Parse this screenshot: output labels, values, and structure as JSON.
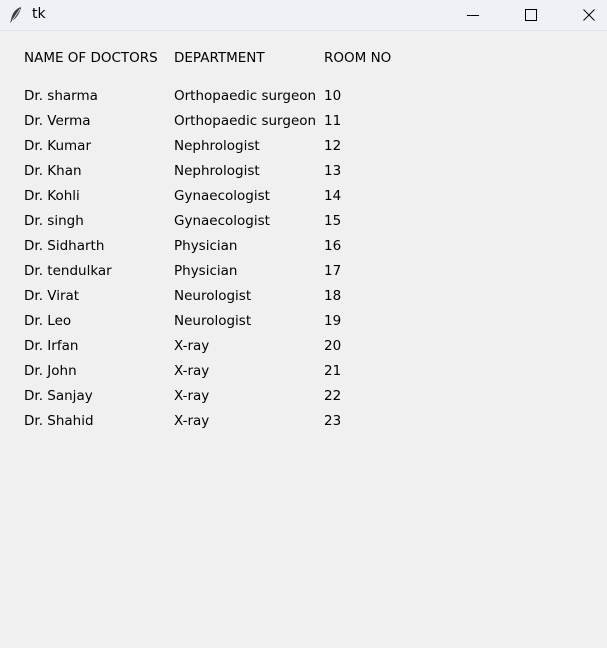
{
  "window": {
    "title": "tk"
  },
  "table": {
    "headers": [
      "NAME OF DOCTORS",
      "DEPARTMENT",
      "ROOM NO"
    ],
    "rows": [
      [
        "Dr. sharma",
        "Orthopaedic surgeon",
        "10"
      ],
      [
        "Dr. Verma",
        "Orthopaedic surgeon",
        "11"
      ],
      [
        "Dr. Kumar",
        "Nephrologist",
        "12"
      ],
      [
        "Dr. Khan",
        "Nephrologist",
        "13"
      ],
      [
        "Dr. Kohli",
        "Gynaecologist",
        "14"
      ],
      [
        "Dr. singh",
        "Gynaecologist",
        "15"
      ],
      [
        "Dr. Sidharth",
        "Physician",
        "16"
      ],
      [
        "Dr. tendulkar",
        "Physician",
        "17"
      ],
      [
        "Dr. Virat",
        "Neurologist",
        "18"
      ],
      [
        "Dr. Leo",
        "Neurologist",
        "19"
      ],
      [
        "Dr. Irfan",
        "X-ray",
        "20"
      ],
      [
        "Dr. John",
        "X-ray",
        "21"
      ],
      [
        "Dr. Sanjay",
        "X-ray",
        "22"
      ],
      [
        "Dr. Shahid",
        "X-ray",
        "23"
      ]
    ]
  }
}
